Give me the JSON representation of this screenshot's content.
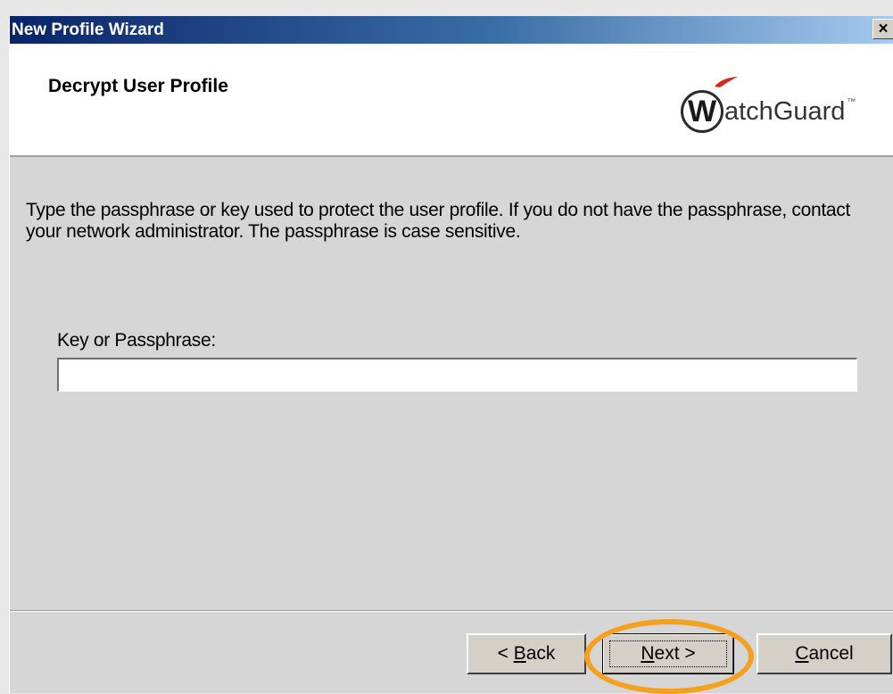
{
  "window": {
    "title": "New Profile Wizard",
    "close_glyph": "×"
  },
  "header": {
    "title": "Decrypt User Profile",
    "logo": {
      "initial": "W",
      "text": "atchGuard",
      "trademark": "™",
      "swoosh_color": "#e2231a"
    }
  },
  "content": {
    "description": "Type the passphrase or key used to protect the user profile. If you do not have the passphrase, contact your network administrator. The passphrase is case sensitive.",
    "field_label": "Key or Passphrase:",
    "field_value": "",
    "field_placeholder": ""
  },
  "buttons": {
    "back_prefix": "< ",
    "back_mnemonic": "B",
    "back_rest": "ack",
    "next_mnemonic": "N",
    "next_rest": "ext >",
    "cancel_mnemonic": "C",
    "cancel_rest": "ancel"
  },
  "colors": {
    "titlebar_start": "#0a246a",
    "highlight_ring": "#f4a11f",
    "dialog_face": "#d6d6d6"
  }
}
